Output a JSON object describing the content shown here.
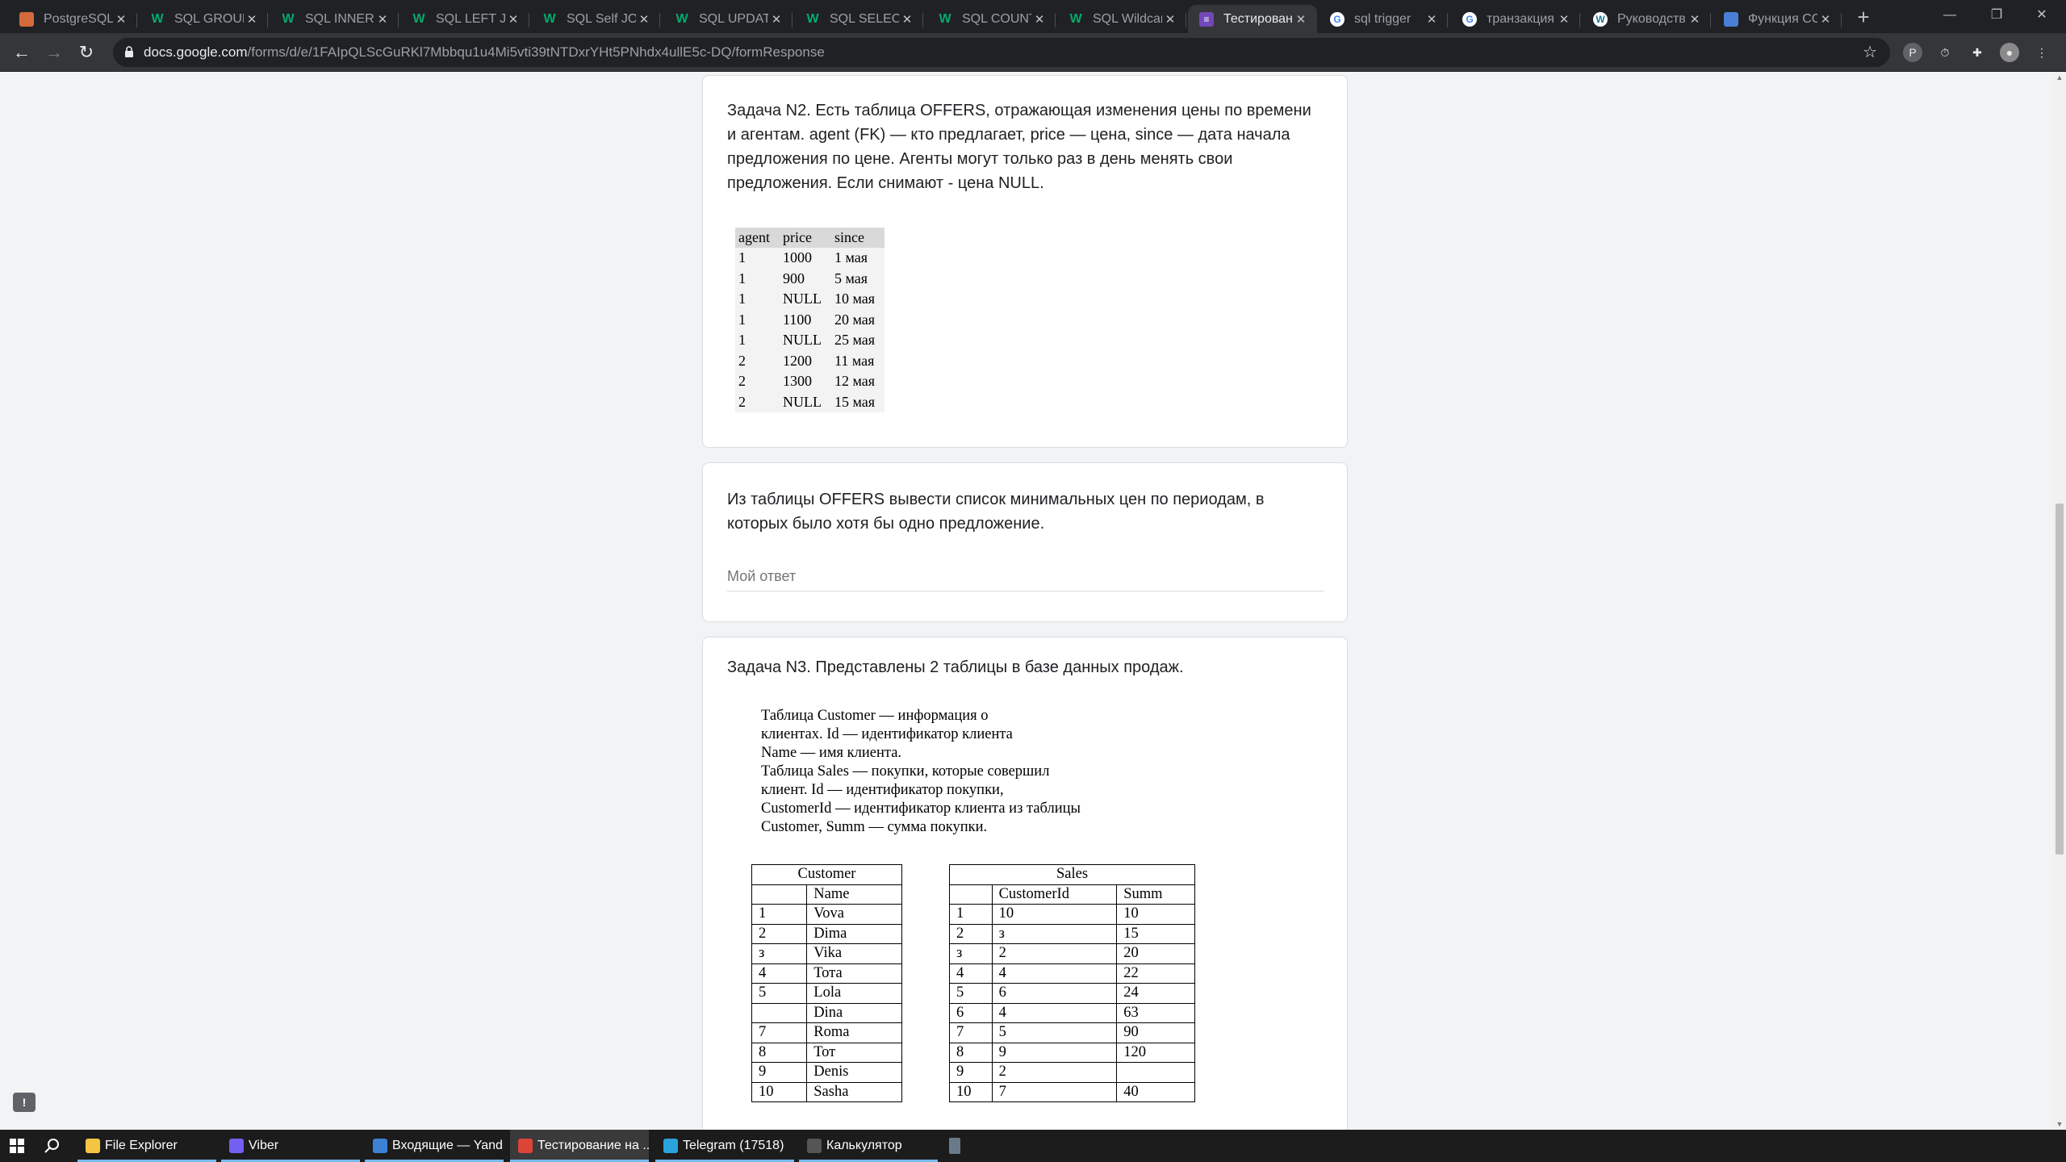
{
  "tabs": [
    {
      "title": "PostgreSQL",
      "favicon": "postgres-favicon",
      "color": "#d46a3b"
    },
    {
      "title": "SQL GROUP",
      "favicon": "w3schools-favicon",
      "color": "#04aa6d"
    },
    {
      "title": "SQL INNER",
      "favicon": "w3schools-favicon",
      "color": "#04aa6d"
    },
    {
      "title": "SQL LEFT JO",
      "favicon": "w3schools-favicon",
      "color": "#04aa6d"
    },
    {
      "title": "SQL Self JO",
      "favicon": "w3schools-favicon",
      "color": "#04aa6d"
    },
    {
      "title": "SQL UPDATE",
      "favicon": "w3schools-favicon",
      "color": "#04aa6d"
    },
    {
      "title": "SQL SELECT",
      "favicon": "w3schools-favicon",
      "color": "#04aa6d"
    },
    {
      "title": "SQL COUNT",
      "favicon": "w3schools-favicon",
      "color": "#04aa6d"
    },
    {
      "title": "SQL Wildcar",
      "favicon": "w3schools-favicon",
      "color": "#04aa6d"
    },
    {
      "title": "Тестирован",
      "favicon": "google-forms-favicon",
      "color": "#7248b9",
      "active": true
    },
    {
      "title": "sql trigger",
      "favicon": "google-favicon",
      "color": "#ffffff"
    },
    {
      "title": "транзакция",
      "favicon": "google-favicon",
      "color": "#ffffff"
    },
    {
      "title": "Руководств",
      "favicon": "wordpress-favicon",
      "color": "#ffffff"
    },
    {
      "title": "Функция CO",
      "favicon": "docs-favicon",
      "color": "#4a7fd8"
    }
  ],
  "toolbar": {
    "url_host": "docs.google.com",
    "url_path": "/forms/d/e/1FAIpQLScGuRKl7Mbbqu1u4Mi5vti39tNTDxrYHt5PNhdx4ullE5c-DQ/formResponse"
  },
  "task2": {
    "text": "Задача N2. Есть таблица OFFERS, отражающая изменения цены по времени и агентам. agent (FK) — кто предлагает, price — цена, since — дата начала предложения по цене. Агенты могут только раз в день менять свои предложения. Если снимают - цена NULL.",
    "headers": [
      "agent",
      "price",
      "since"
    ],
    "rows": [
      [
        "1",
        "1000",
        "1 мая"
      ],
      [
        "1",
        "900",
        "5 мая"
      ],
      [
        "1",
        "NULL",
        "10 мая"
      ],
      [
        "1",
        "1100",
        "20 мая"
      ],
      [
        "1",
        "NULL",
        "25 мая"
      ],
      [
        "2",
        "1200",
        "11 мая"
      ],
      [
        "2",
        "1300",
        "12 мая"
      ],
      [
        "2",
        "NULL",
        "15 мая"
      ]
    ]
  },
  "question": {
    "text": "Из таблицы OFFERS вывести список минимальных цен по периодам, в которых было хотя бы одно предложение.",
    "placeholder": "Мой ответ"
  },
  "task3": {
    "text": "Задача N3. Представлены 2 таблицы в базе данных продаж.",
    "desc_lines": [
      "Таблица Customer — информация о",
      "клиентах. Id — идентификатор клиента",
      "Name — имя клиента.",
      "Таблица Sales — покупки, которые совершил",
      "клиент. Id — идентификатор покупки,",
      "CustomerId — идентификатор клиента из таблицы",
      "Customer, Summ — сумма покупки."
    ],
    "customer": {
      "caption": "Customer",
      "headers": [
        "",
        "Name"
      ],
      "rows": [
        [
          "1",
          "Vova"
        ],
        [
          "2",
          "Dima"
        ],
        [
          "з",
          "Vika"
        ],
        [
          "4",
          "Тота"
        ],
        [
          "5",
          "Lola"
        ],
        [
          "",
          "Dina"
        ],
        [
          "7",
          "Roma"
        ],
        [
          "8",
          "Тот"
        ],
        [
          "9",
          "Denis"
        ],
        [
          "10",
          "Sasha"
        ]
      ]
    },
    "sales": {
      "caption": "Sales",
      "headers": [
        "",
        "CustomerId",
        "Summ"
      ],
      "rows": [
        [
          "1",
          "10",
          "10"
        ],
        [
          "2",
          "з",
          "15"
        ],
        [
          "з",
          "2",
          "20"
        ],
        [
          "4",
          "4",
          "22"
        ],
        [
          "5",
          "6",
          "24"
        ],
        [
          "6",
          "4",
          "63"
        ],
        [
          "7",
          "5",
          "90"
        ],
        [
          "8",
          "9",
          "120"
        ],
        [
          "9",
          "2",
          ""
        ],
        [
          "10",
          "7",
          "40"
        ]
      ]
    }
  },
  "taskbar": [
    {
      "label": "File Explorer",
      "icon": "folder-icon",
      "color": "#f4c542"
    },
    {
      "label": "Viber",
      "icon": "viber-icon",
      "color": "#7360f2"
    },
    {
      "label": "Входящие — Yand...",
      "icon": "mail-icon",
      "color": "#3b82d6"
    },
    {
      "label": "Тестирование на ...",
      "icon": "chrome-icon",
      "color": "#db4437",
      "active": true
    },
    {
      "label": "Telegram (17518)",
      "icon": "telegram-icon",
      "color": "#2aa3dc"
    },
    {
      "label": "Калькулятор",
      "icon": "calculator-icon",
      "color": "#555555"
    }
  ]
}
